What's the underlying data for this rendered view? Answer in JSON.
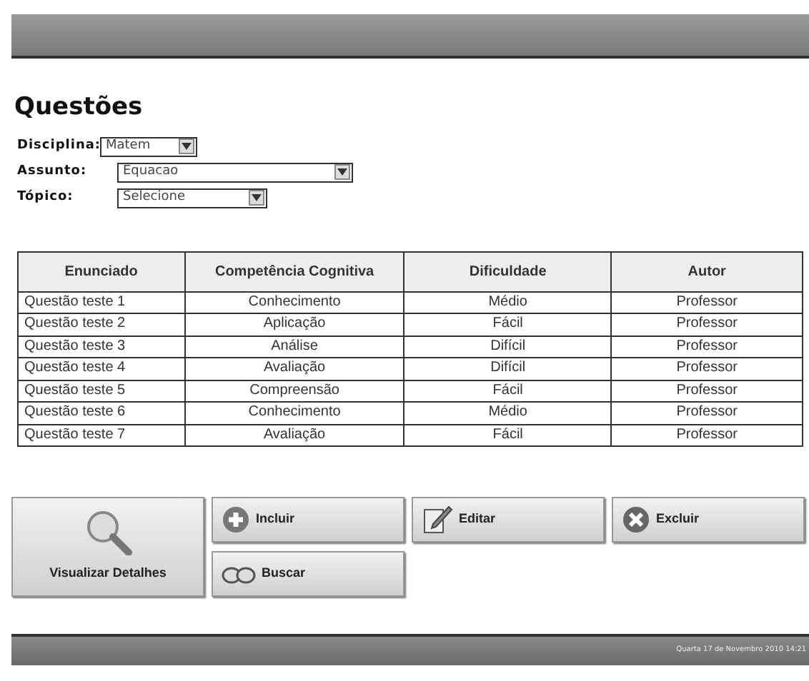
{
  "title": "Questões",
  "filters": [
    {
      "label": "Disciplina:",
      "value": "Matem"
    },
    {
      "label": "Assunto:",
      "value": "Equacao"
    },
    {
      "label": "Tópico:",
      "value": "Selecione"
    }
  ],
  "table": {
    "columns": [
      "Enunciado",
      "Competência Cognitiva",
      "Dificuldade",
      "Autor"
    ],
    "rows": [
      [
        "Questão teste 1",
        "Conhecimento",
        "Médio",
        "Professor"
      ],
      [
        "Questão teste 2",
        "Aplicação",
        "Fácil",
        "Professor"
      ],
      [
        "Questão teste 3",
        "Análise",
        "Difícil",
        "Professor"
      ],
      [
        "Questão teste 4",
        "Avaliação",
        "Difícil",
        "Professor"
      ],
      [
        "Questão teste 5",
        "Compreensão",
        "Fácil",
        "Professor"
      ],
      [
        "Questão teste 6",
        "Conhecimento",
        "Médio",
        "Professor"
      ],
      [
        "Questão teste 7",
        "Avaliação",
        "Fácil",
        "Professor"
      ]
    ]
  },
  "details_button": {
    "label": "Visualizar Detalhes",
    "kind": "magnifier"
  },
  "buttons": [
    {
      "label": "Incluir",
      "kind": "plus"
    },
    {
      "label": "Editar",
      "kind": "edit"
    },
    {
      "label": "Excluir",
      "kind": "delete"
    },
    {
      "label": "Buscar",
      "kind": "binoculars"
    }
  ],
  "status_bar": "Quarta 17 de Novembro 2010 14:21"
}
